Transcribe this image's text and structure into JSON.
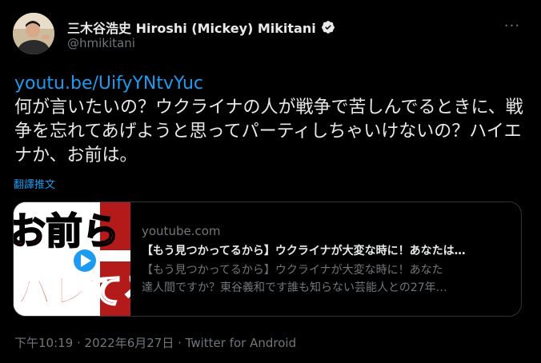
{
  "author": {
    "display_name": "三木谷浩史 Hiroshi (Mickey) Mikitani",
    "handle": "@hmikitani",
    "verified_icon": "verified-badge-icon"
  },
  "menu": {
    "more_label": "···"
  },
  "tweet": {
    "link": "youtu.be/UifyYNtvYuc",
    "text": "何が言いたいの？ウクライナの人が戦争で苦しんでるときに、戦争を忘れてあげようと思ってパーティしちゃいけないの？ハイエナか、お前は。",
    "translate_label": "翻譯推文"
  },
  "card": {
    "thumbnail_text_top": "お前ら",
    "thumbnail_text_bottom": "らバレてる",
    "play_icon": "play-icon",
    "domain": "youtube.com",
    "title": "【もう見つかってるから】ウクライナが大変な時に！あなたは…",
    "description_line1": "【もう見つかってるから】ウクライナが大変な時に！あなた",
    "description_line2": "達人間ですか？東谷義和です誰も知らない芸能人との27年…"
  },
  "meta": {
    "time": "下午10:19",
    "separator1": " · ",
    "date": "2022年6月27日",
    "separator2": " · ",
    "source": "Twitter for Android"
  },
  "colors": {
    "background": "#000000",
    "text": "#e7e9ea",
    "muted": "#71767b",
    "link": "#1d9bf0",
    "border": "#2f3336"
  }
}
